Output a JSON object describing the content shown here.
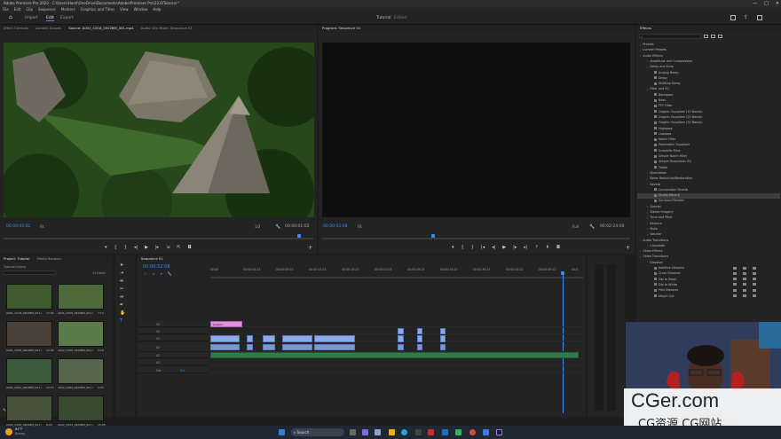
{
  "window": {
    "title": "Adobe Premiere Pro 2023 - C:\\Users\\Haml\\OneDrive\\Documents\\Adobe\\Premiere Pro\\23.0\\Tutorial *",
    "controls": [
      "—",
      "□",
      "✕"
    ]
  },
  "menu": [
    "File",
    "Edit",
    "Clip",
    "Sequence",
    "Markers",
    "Graphics and Titles",
    "View",
    "Window",
    "Help"
  ],
  "header": {
    "tabs": [
      "Import",
      "Edit",
      "Export"
    ],
    "center": "Tutorial",
    "center_sub": "Edited"
  },
  "source": {
    "tabs": [
      "Effect Controls",
      "Lumetri Scopes",
      "Source: A001_C018_0922BM_001.mp4",
      "Audio Clip Mixer: Sequence 01"
    ],
    "timecode_left": "00:00:01:02",
    "fit": "Fit",
    "fraction": "1/2",
    "timecode_right": "00:00:01:02"
  },
  "program": {
    "tab": "Program: Sequence 01",
    "timecode_left": "00:00:52:08",
    "fit": "Fit",
    "quality": "Full",
    "timecode_right": "00:02:24:00"
  },
  "effects": {
    "title": "Effects",
    "items": [
      {
        "label": "Presets",
        "indent": 0
      },
      {
        "label": "Lumetri Presets",
        "indent": 0
      },
      {
        "label": "Audio Effects",
        "indent": 0
      },
      {
        "label": "Amplitude and Compression",
        "indent": 1
      },
      {
        "label": "Delay and Echo",
        "indent": 1
      },
      {
        "label": "Analog Delay",
        "indent": 2
      },
      {
        "label": "Delay",
        "indent": 2
      },
      {
        "label": "Multitap Delay",
        "indent": 2
      },
      {
        "label": "Filter and EQ",
        "indent": 1
      },
      {
        "label": "Bandpass",
        "indent": 2
      },
      {
        "label": "Bass",
        "indent": 2
      },
      {
        "label": "FFT Filter",
        "indent": 2
      },
      {
        "label": "Graphic Equalizer (10 Bands)",
        "indent": 2
      },
      {
        "label": "Graphic Equalizer (20 Bands)",
        "indent": 2
      },
      {
        "label": "Graphic Equalizer (30 Bands)",
        "indent": 2
      },
      {
        "label": "Highpass",
        "indent": 2
      },
      {
        "label": "Lowpass",
        "indent": 2
      },
      {
        "label": "Notch Filter",
        "indent": 2
      },
      {
        "label": "Parametric Equalizer",
        "indent": 2
      },
      {
        "label": "Scientific Filter",
        "indent": 2
      },
      {
        "label": "Simple Notch Filter",
        "indent": 2
      },
      {
        "label": "Simple Parametric EQ",
        "indent": 2
      },
      {
        "label": "Treble",
        "indent": 2
      },
      {
        "label": "Modulation",
        "indent": 1
      },
      {
        "label": "Noise Reduction/Restoration",
        "indent": 1
      },
      {
        "label": "Reverb",
        "indent": 1
      },
      {
        "label": "Convolution Reverb",
        "indent": 2
      },
      {
        "label": "Studio Reverb",
        "indent": 2,
        "selected": true
      },
      {
        "label": "Surround Reverb",
        "indent": 2
      },
      {
        "label": "Special",
        "indent": 1
      },
      {
        "label": "Stereo Imagery",
        "indent": 1
      },
      {
        "label": "Time and Pitch",
        "indent": 1
      },
      {
        "label": "Balance",
        "indent": 1
      },
      {
        "label": "Mute",
        "indent": 1
      },
      {
        "label": "Volume",
        "indent": 1
      },
      {
        "label": "Audio Transitions",
        "indent": 0
      },
      {
        "label": "Crossfade",
        "indent": 1
      },
      {
        "label": "Video Effects",
        "indent": 0
      },
      {
        "label": "Video Transitions",
        "indent": 0
      },
      {
        "label": "Dissolve",
        "indent": 1
      },
      {
        "label": "Additive Dissolve",
        "indent": 2
      },
      {
        "label": "Cross Dissolve",
        "indent": 2
      },
      {
        "label": "Dip to Black",
        "indent": 2
      },
      {
        "label": "Dip to White",
        "indent": 2
      },
      {
        "label": "Film Dissolve",
        "indent": 2
      },
      {
        "label": "Morph Cut",
        "indent": 2
      }
    ]
  },
  "project": {
    "tabs": [
      "Project: Tutorial",
      "Media Browser"
    ],
    "file": "Tutorial.prproj",
    "count": "11 Items",
    "clips": [
      {
        "name": "A001_C018_0922BM_001.mp4",
        "dur": "12:04"
      },
      {
        "name": "A001_C028_0922BM_001.mp4",
        "dur": "7:13"
      },
      {
        "name": "A001_C058_0922BM_001.mp4",
        "dur": "10:05"
      },
      {
        "name": "A002_C028_0922BM_001.mp4",
        "dur": "5:16"
      },
      {
        "name": "A002_C061_0922BM_001.mp4",
        "dur": "10:15"
      },
      {
        "name": "A002_C064_0922BM_001.mp4",
        "dur": "2:04"
      },
      {
        "name": "A002_C049_0922BM_001.mp4",
        "dur": "8:02"
      },
      {
        "name": "A002_C054_0922BM_001.mp4",
        "dur": "15:05"
      }
    ]
  },
  "timeline": {
    "tab": "Sequence 01",
    "timecode": "00:00:52:08",
    "ruler": [
      "00:00",
      "00:00:04:23",
      "00:00:09:23",
      "00:00:14:23",
      "00:00:19:23",
      "00:00:24:23",
      "00:00:29:23",
      "00:00:34:23",
      "00:00:39:23",
      "00:00:44:22",
      "00:00:49:22",
      "00:0"
    ],
    "tracks": [
      "V3",
      "V2",
      "V1",
      "A1",
      "A2",
      "A3",
      "Mix"
    ],
    "mix_value": "0.0",
    "graphic_label": "Graphic"
  },
  "taskbar": {
    "weather_temp": "84°F",
    "weather_cond": "Sunny",
    "search": "Search"
  },
  "watermark": {
    "text": "CGer.com",
    "sub": "CG资源 CG网站"
  },
  "colors": {
    "accent": "#3d8bff",
    "clip_video": "#8ea9e6",
    "clip_audio": "#2e7d4a",
    "clip_graphic": "#e58ee1"
  }
}
